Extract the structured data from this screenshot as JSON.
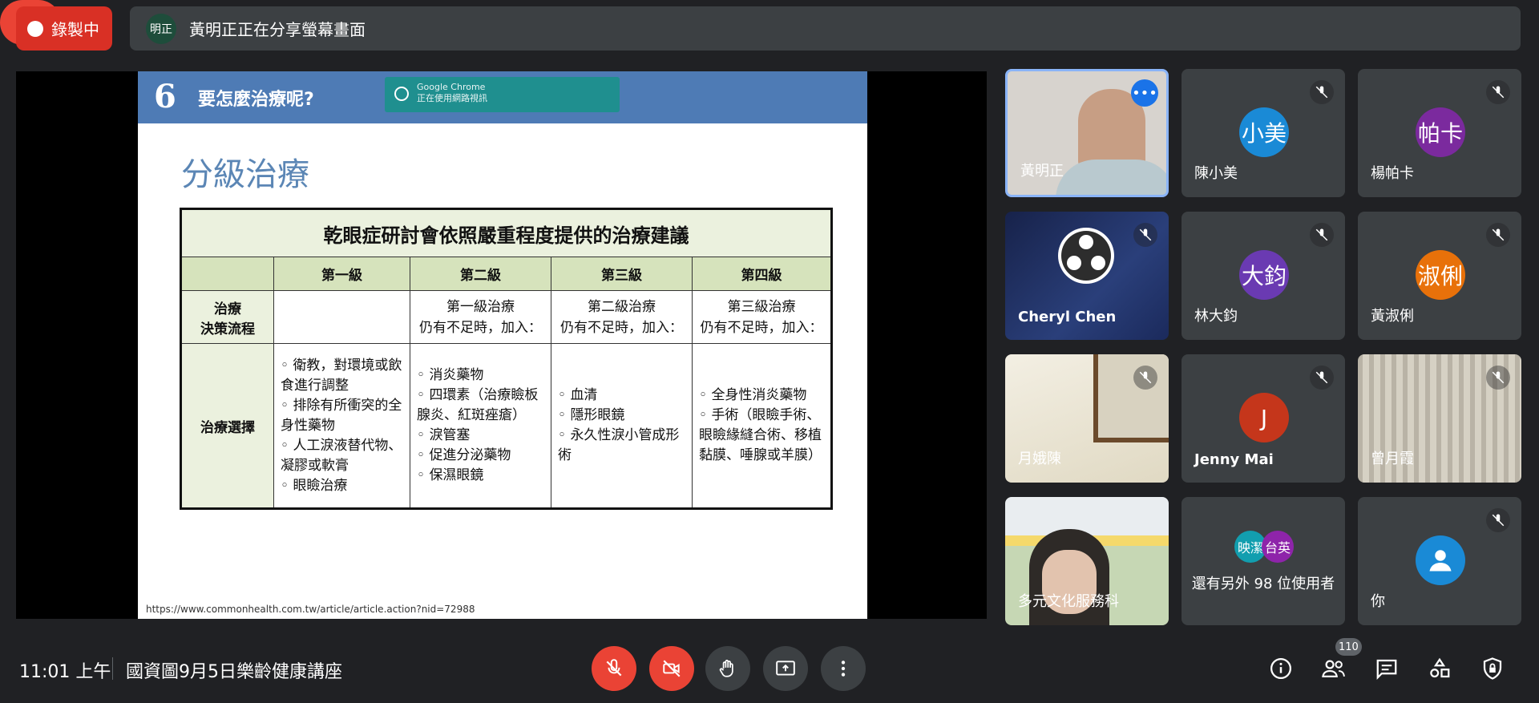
{
  "recording": {
    "label": "錄製中"
  },
  "presenting": {
    "avatar_text": "明正",
    "text": "黃明正正在分享螢幕畫面"
  },
  "slide": {
    "number": "6",
    "header_title": "要怎麼治療呢?",
    "chrome_notice": {
      "line1": "Google Chrome",
      "line2": "正在使用網路視訊"
    },
    "title": "分級治療",
    "table": {
      "caption": "乾眼症研討會依照嚴重程度提供的治療建議",
      "headers": [
        "第一級",
        "第二級",
        "第三級",
        "第四級"
      ],
      "row1": {
        "label": "治療\n決策流程",
        "cells": [
          "",
          "第一級治療\n仍有不足時，加入：",
          "第二級治療\n仍有不足時，加入：",
          "第三級治療\n仍有不足時，加入："
        ]
      },
      "row2": {
        "label": "治療選擇",
        "col1": [
          "衛教，對環境或飲食進行調整",
          "排除有所衝突的全身性藥物",
          "人工淚液替代物、凝膠或軟膏",
          "眼瞼治療"
        ],
        "col2": [
          "消炎藥物",
          "四環素（治療瞼板腺炎、紅斑痤瘡）",
          "淚管塞",
          "促進分泌藥物",
          "保濕眼鏡"
        ],
        "col3": [
          "血清",
          "隱形眼鏡",
          "永久性淚小管成形術"
        ],
        "col4": [
          "全身性消炎藥物",
          "手術（眼瞼手術、眼瞼緣縫合術、移植黏膜、唾腺或羊膜）"
        ]
      }
    },
    "url": "https://www.commonhealth.com.tw/article/article.action?nid=72988"
  },
  "participants": [
    {
      "name": "黃明正"
    },
    {
      "name": "陳小美",
      "avatar": "小美",
      "color": "#1a8ad6"
    },
    {
      "name": "楊帕卡",
      "avatar": "帕卡",
      "color": "#7b2a9e"
    },
    {
      "name": "Cheryl Chen"
    },
    {
      "name": "林大鈞",
      "avatar": "大鈞",
      "color": "#6a3ab2"
    },
    {
      "name": "黃淑俐",
      "avatar": "淑俐",
      "color": "#e8710a"
    },
    {
      "name": "月娥陳"
    },
    {
      "name": "Jenny Mai",
      "avatar": "J",
      "color": "#c5361b"
    },
    {
      "name": "曾月霞"
    },
    {
      "name": "多元文化服務科"
    },
    {
      "name": "還有另外 98 位使用者",
      "avatar1": "映潔",
      "avatar2": "台英"
    },
    {
      "name": "你"
    }
  ],
  "bottom": {
    "time": "11:01 上午",
    "meeting_title": "國資圖9月5日樂齡健康講座",
    "people_count": "110"
  }
}
